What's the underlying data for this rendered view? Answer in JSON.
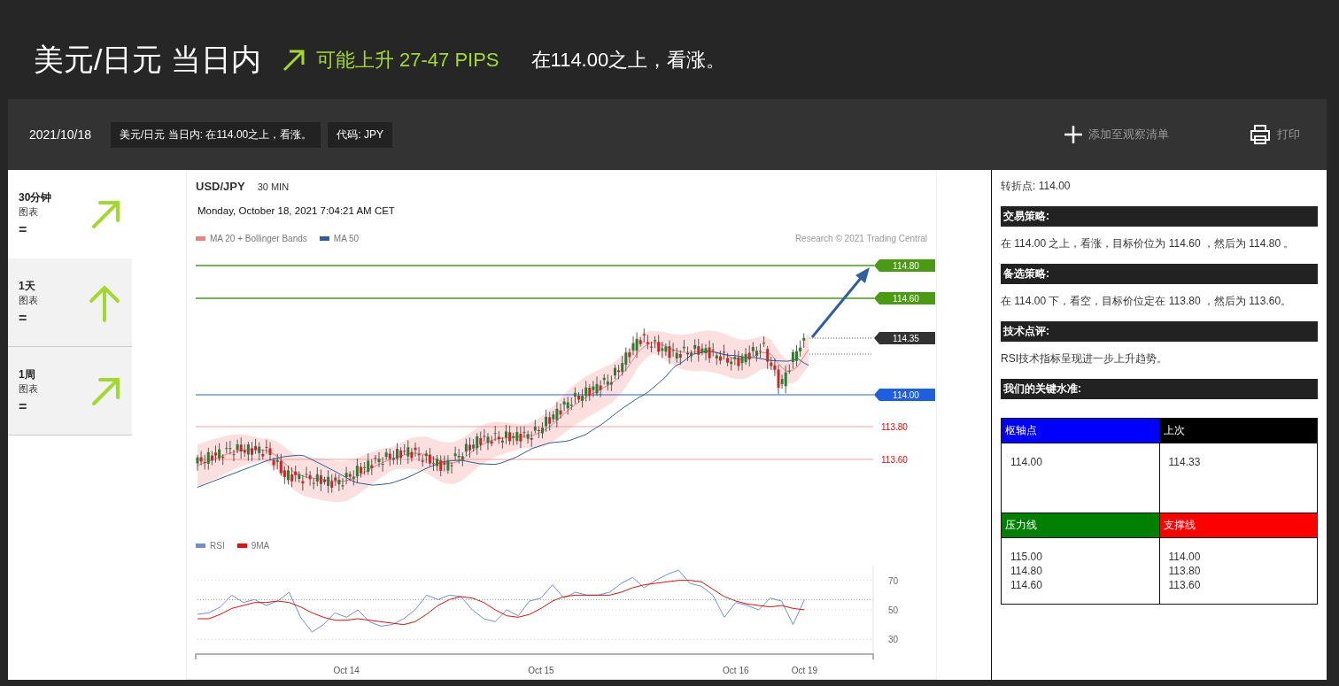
{
  "header": {
    "title": "美元/日元 当日内",
    "outlook": "可能上升 27-47 PIPS",
    "summary": "在114.00之上，看涨。"
  },
  "toolbar": {
    "date": "2021/10/18",
    "tags": [
      "美元/日元 当日内: 在114.00之上，看涨。",
      "代码: JPY"
    ],
    "watchlist": "添加至观察清单",
    "print": "打印"
  },
  "timeframes": [
    {
      "label": "30分钟",
      "sub": "图表",
      "sign": "=",
      "kind": "up-right",
      "selected": true
    },
    {
      "label": "1天",
      "sub": "图表",
      "sign": "=",
      "kind": "up",
      "selected": false
    },
    {
      "label": "1周",
      "sub": "图表",
      "sign": "=",
      "kind": "up-right",
      "selected": false
    }
  ],
  "chart": {
    "symbol": "USD/JPY",
    "interval": "30 MIN",
    "timestamp": "Monday, October 18, 2021 7:04:21 AM CET",
    "legend": [
      {
        "label": "MA 20 + Bollinger Bands",
        "color": "#f08080"
      },
      {
        "label": "MA 50",
        "color": "#2f5f9e"
      }
    ],
    "credit": "Research © 2021 Trading Central",
    "levels": [
      {
        "label": "114.80",
        "kind": "target"
      },
      {
        "label": "114.60",
        "kind": "target"
      },
      {
        "label": "114.35",
        "kind": "current"
      },
      {
        "label": "114.00",
        "kind": "pivot"
      },
      {
        "label": "113.80",
        "kind": "support"
      },
      {
        "label": "113.60",
        "kind": "support"
      }
    ],
    "chart_data": {
      "type": "line",
      "grid": true,
      "yticks": [
        30,
        50,
        70
      ],
      "ylim": [
        20,
        80
      ],
      "ref_lines": [
        {
          "axis": "y",
          "value": 57
        }
      ],
      "categories": [
        null,
        null,
        null,
        null,
        null,
        null,
        null,
        null,
        null,
        null,
        null,
        null,
        null,
        "Oct 14",
        null,
        null,
        null,
        null,
        null,
        null,
        null,
        null,
        null,
        null,
        null,
        null,
        null,
        null,
        null,
        null,
        "Oct 15",
        null,
        null,
        null,
        null,
        null,
        null,
        null,
        null,
        null,
        null,
        null,
        null,
        null,
        null,
        null,
        null,
        "Oct 16",
        null,
        null,
        null,
        null,
        null,
        "Oct 19"
      ],
      "series": [
        {
          "name": "RSI",
          "color": "#6b8fd6",
          "values": [
            47,
            48,
            52,
            60,
            55,
            57,
            53,
            56,
            62,
            45,
            35,
            40,
            48,
            45,
            50,
            42,
            39,
            40,
            44,
            50,
            60,
            57,
            60,
            59,
            50,
            44,
            42,
            50,
            46,
            56,
            58,
            67,
            58,
            62,
            60,
            60,
            62,
            68,
            72,
            65,
            70,
            74,
            77,
            68,
            66,
            60,
            45,
            55,
            53,
            50,
            58,
            56,
            40,
            57
          ]
        },
        {
          "name": "9MA",
          "color": "#e01010",
          "values": [
            44,
            44,
            47,
            51,
            53,
            55,
            55,
            56,
            55,
            52,
            48,
            45,
            43,
            43,
            44,
            43,
            42,
            41,
            40,
            42,
            47,
            53,
            57,
            59,
            58,
            55,
            50,
            46,
            45,
            47,
            51,
            56,
            59,
            60,
            60,
            60,
            60,
            62,
            65,
            67,
            68,
            69,
            70,
            70,
            69,
            64,
            59,
            56,
            54,
            53,
            52,
            53,
            51,
            50
          ]
        }
      ]
    }
  },
  "analysis": {
    "pivot": "转折点: 114.00",
    "sections": [
      {
        "heading": "交易策略:",
        "text": "在 114.00 之上，看涨，目标价位为 114.60 ，然后为 114.80 。"
      },
      {
        "heading": "备选策略:",
        "text": "在 114.00 下，看空，目标价位定在 113.80 ，然后为 113.60。"
      },
      {
        "heading": "技术点评:",
        "text": "RSI技术指标呈现进一步上升趋势。"
      },
      {
        "heading": "我们的关键水准:"
      }
    ],
    "levels_table": [
      {
        "heading": "枢轴点",
        "color": "#0000ff",
        "values": [
          "114.00"
        ]
      },
      {
        "heading": "上次",
        "color": "#000000",
        "values": [
          "114.33"
        ]
      },
      {
        "heading": "压力线",
        "color": "#008000",
        "values": [
          "115.00",
          "114.80",
          "114.60"
        ]
      },
      {
        "heading": "支撑线",
        "color": "#ff0000",
        "values": [
          "114.00",
          "113.80",
          "113.60"
        ]
      }
    ]
  }
}
